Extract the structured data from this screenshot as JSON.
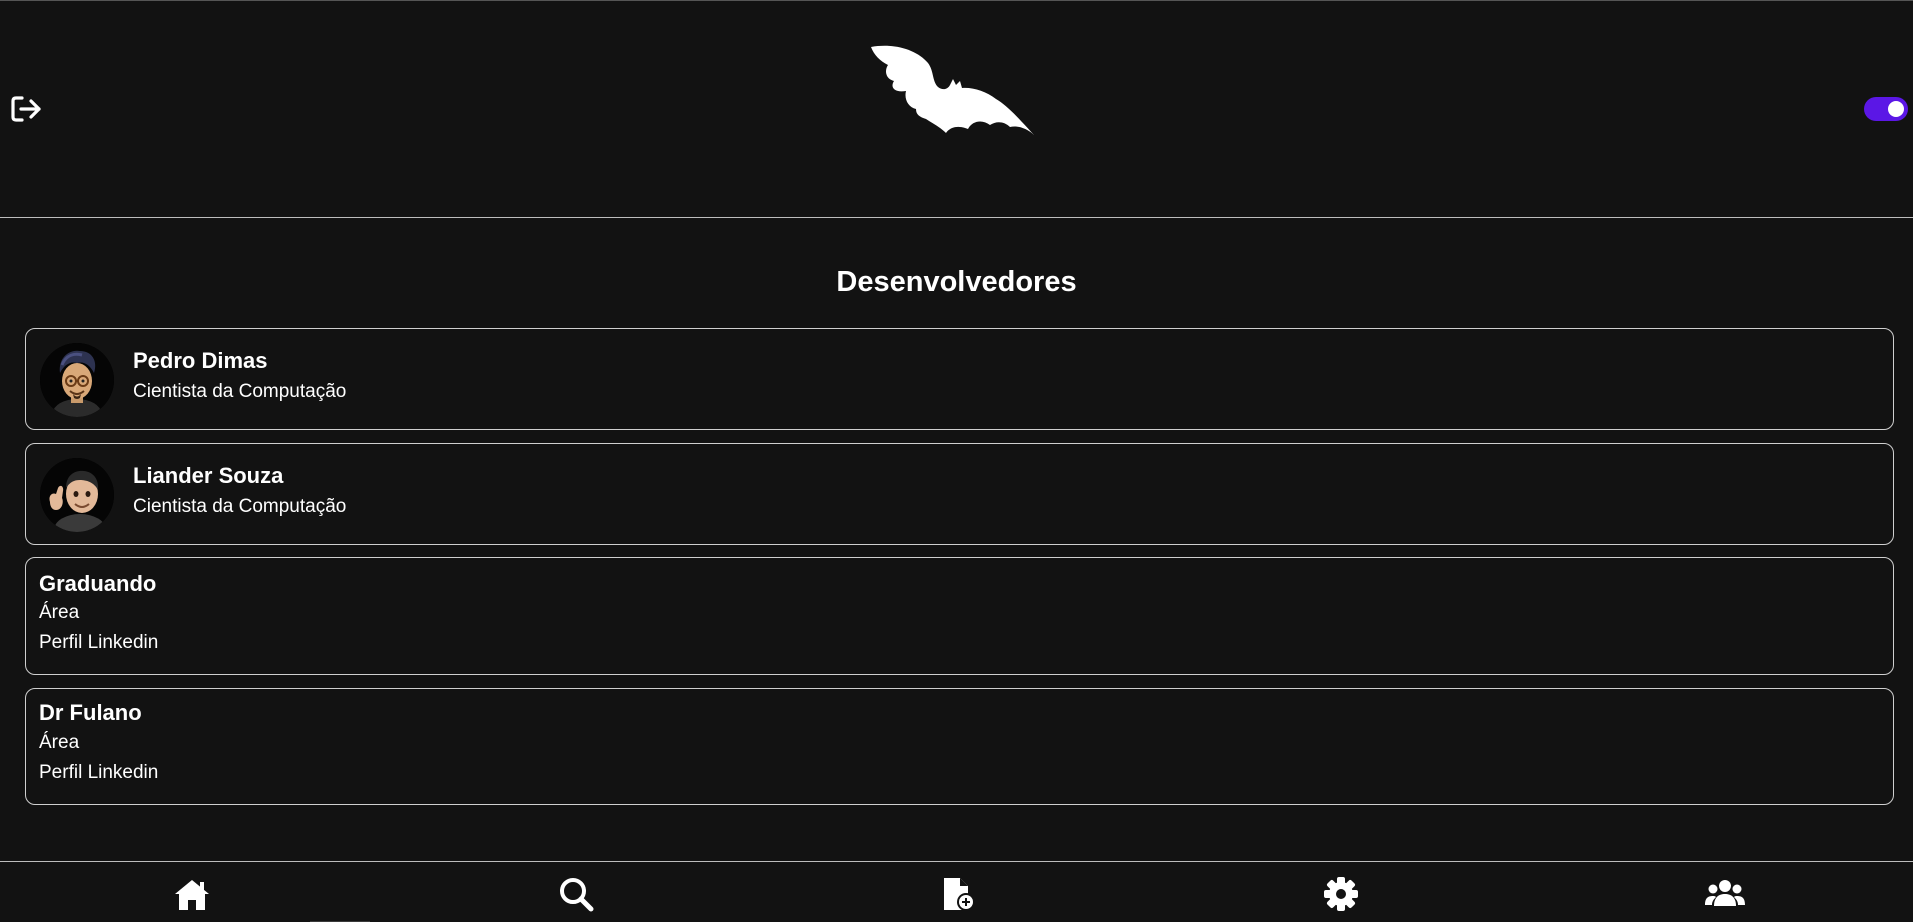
{
  "header": {
    "logout_icon": "logout-icon",
    "logo_icon": "bat-logo",
    "theme_toggle_state": "on",
    "accent_color": "#5b17e6"
  },
  "main": {
    "title": "Desenvolvedores",
    "developers": [
      {
        "name": "Pedro Dimas",
        "role": "Cientista da Computação",
        "avatar": "avatar-pedro"
      },
      {
        "name": "Liander Souza",
        "role": "Cientista da Computação",
        "avatar": "avatar-liander"
      }
    ],
    "advisors": [
      {
        "name": "Graduando",
        "area": "Área",
        "linkedin": "Perfil Linkedin"
      },
      {
        "name": "Dr Fulano",
        "area": "Área",
        "linkedin": "Perfil Linkedin"
      }
    ]
  },
  "bottom_nav": {
    "items": [
      {
        "icon": "home-icon"
      },
      {
        "icon": "search-icon"
      },
      {
        "icon": "file-add-icon"
      },
      {
        "icon": "gear-icon"
      },
      {
        "icon": "users-icon"
      }
    ]
  },
  "colors": {
    "background": "#121212",
    "border": "#cfcfcf",
    "text": "#ffffff"
  }
}
